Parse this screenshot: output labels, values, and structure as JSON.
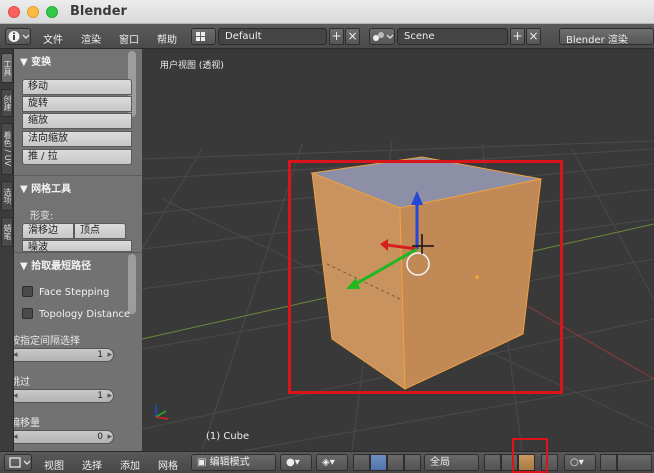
{
  "window": {
    "title": "Blender"
  },
  "menu": {
    "items": [
      "文件",
      "渲染",
      "窗口",
      "帮助"
    ]
  },
  "screen_layout": {
    "value": "Default"
  },
  "scene": {
    "value": "Scene"
  },
  "render_engine": {
    "value": "Blender 渲染"
  },
  "tabs": [
    "工具",
    "创建",
    "着色 / UV",
    "选项",
    "蜡笔"
  ],
  "transform_panel": {
    "title": "▼ 变换",
    "buttons": [
      "移动",
      "旋转",
      "缩放",
      "法向缩放",
      "推 / 拉"
    ]
  },
  "mesh_tools_panel": {
    "title": "▼ 网格工具",
    "deform_label": "形变:",
    "buttons": [
      "滑移边",
      "顶点",
      "噪波"
    ]
  },
  "shortest_path_panel": {
    "title": "▼ 拾取最短路径",
    "face_stepping": "Face Stepping",
    "topology_distance": "Topology Distance",
    "nth_label": "按指定间隔选择",
    "nth_value": "1",
    "skip_label": "跳过",
    "skip_value": "1",
    "offset_label": "偏移量",
    "offset_value": "0"
  },
  "viewport": {
    "view_label": "用户视图 (透视)",
    "object_label": "(1) Cube"
  },
  "bottom": {
    "menus": [
      "视图",
      "选择",
      "添加",
      "网格"
    ],
    "mode": "编辑模式",
    "orientation": "全局"
  },
  "colors": {
    "highlight": "#d9151b",
    "cube_face": "#c8935f",
    "cube_top": "#8c8fa6"
  }
}
